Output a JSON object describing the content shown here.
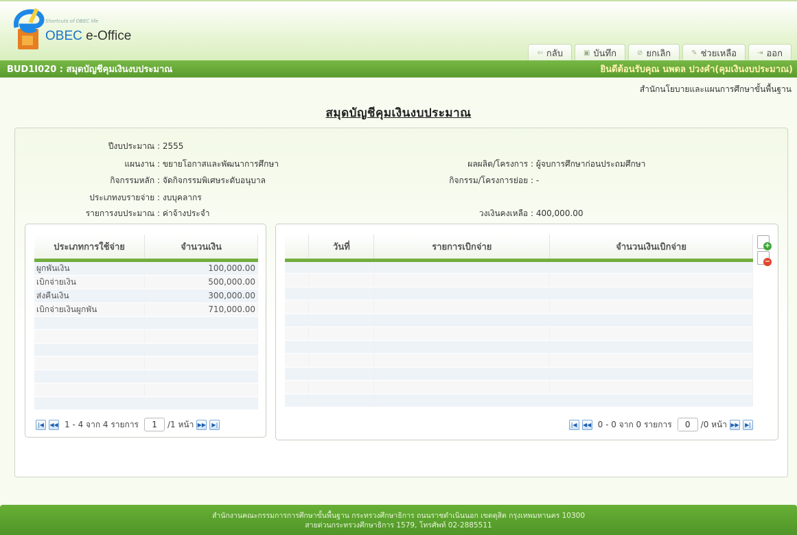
{
  "app": {
    "tagline": "Shortcuts of OBEC life",
    "name_prefix": "OBEC",
    "name_suffix": " e-Office"
  },
  "toolbar": {
    "back": "กลับ",
    "save": "บันทึก",
    "cancel": "ยกเลิก",
    "help": "ช่วยเหลือ",
    "exit": "ออก"
  },
  "titlebar": {
    "code_title": "BUD1I020 : สมุดบัญชีคุมเงินงบประมาณ",
    "welcome": "ยินดีต้อนรับคุณ นพดล ปวงคำ(คุมเงินงบประมาณ)"
  },
  "org_name": "สำนักนโยบายและแผนการศึกษาขั้นพื้นฐาน",
  "page_title": "สมุดบัญชีคุมเงินงบประมาณ",
  "info": {
    "fiscal_year_label": "ปีงบประมาณ :",
    "fiscal_year": "2555",
    "plan_label": "แผนงาน :",
    "plan": "ขยายโอกาสและพัฒนาการศึกษา",
    "output_label": "ผลผลิต/โครงการ :",
    "output": "ผู้จบการศึกษาก่อนประถมศึกษา",
    "main_activity_label": "กิจกรรมหลัก :",
    "main_activity": "จัดกิจกรรมพิเศษระดับอนุบาล",
    "sub_activity_label": "กิจกรรม/โครงการย่อย :",
    "sub_activity": "-",
    "expense_type_label": "ประเภทงบรายจ่าย :",
    "expense_type": "งบบุคลากร",
    "budget_item_label": "รายการงบประมาณ :",
    "budget_item": "ค่าจ้างประจำ",
    "balance_label": "วงเงินคงเหลือ :",
    "balance": "400,000.00"
  },
  "spend_table": {
    "headers": [
      "ประเภทการใช้จ่าย",
      "จำนวนเงิน"
    ],
    "rows": [
      {
        "type": "ผูกพันเงิน",
        "amount": "100,000.00"
      },
      {
        "type": "เบิกจ่ายเงิน",
        "amount": "500,000.00"
      },
      {
        "type": "ส่งคืนเงิน",
        "amount": "300,000.00"
      },
      {
        "type": "เบิกจ่ายเงินผูกพัน",
        "amount": "710,000.00"
      }
    ],
    "pager": {
      "summary": "1 - 4 จาก 4 รายการ",
      "page": "1",
      "total": "/1 หน้า"
    }
  },
  "disburse_table": {
    "headers": [
      "",
      "วันที่",
      "รายการเบิกจ่าย",
      "จำนวนเงินเบิกจ่าย"
    ],
    "pager": {
      "summary": "0 - 0 จาก 0 รายการ",
      "page": "0",
      "total": "/0 หน้า"
    }
  },
  "footer": {
    "line1": "สำนักงานคณะกรรมการการศึกษาขั้นพื้นฐาน กระทรวงศึกษาธิการ ถนนราชดำเนินนอก เขตดุสิต กรุงเทพมหานคร 10300",
    "line2": "สายด่วนกระทรวงศึกษาธิการ 1579, โทรศัพท์ 02-2885511"
  }
}
